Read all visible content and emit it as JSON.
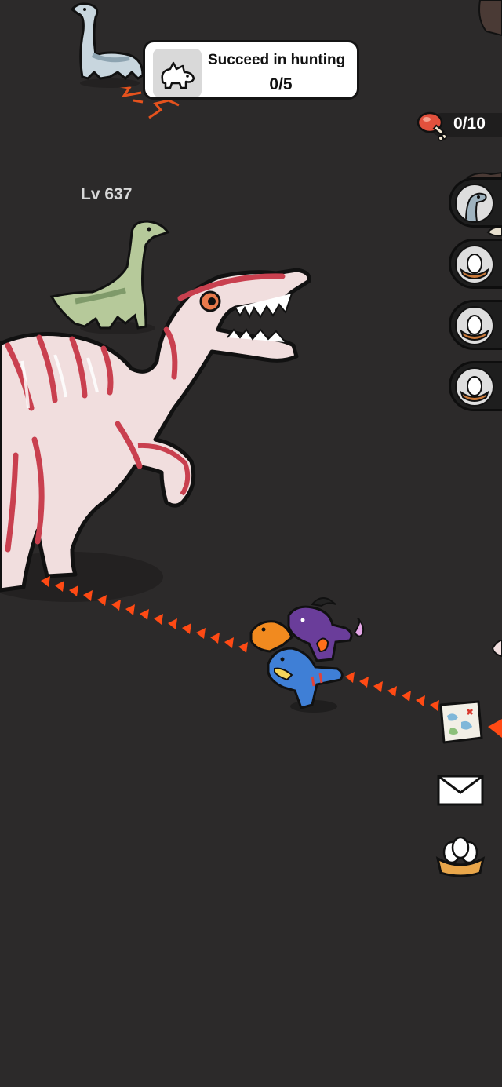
{
  "quest": {
    "title": "Succeed in hunting",
    "progress": "0/5",
    "icon": "triceratops-icon"
  },
  "meat_counter": {
    "icon": "meat-icon",
    "value": "0/10"
  },
  "boss": {
    "level_label": "Lv 637",
    "species": "spinosaurus",
    "colors": {
      "body": "#f1dede",
      "stripes": "#c9404f",
      "outline": "#111111"
    }
  },
  "side_slots": [
    {
      "icon": "dino-portrait-icon"
    },
    {
      "icon": "egg-nest-icon"
    },
    {
      "icon": "egg-nest-icon"
    },
    {
      "icon": "egg-nest-icon"
    }
  ],
  "side_buttons": [
    {
      "icon": "map-icon"
    },
    {
      "icon": "mail-icon"
    },
    {
      "icon": "egg-nest-icon"
    }
  ],
  "path_color": "#ff4a14",
  "background_color": "#2c2a2a"
}
